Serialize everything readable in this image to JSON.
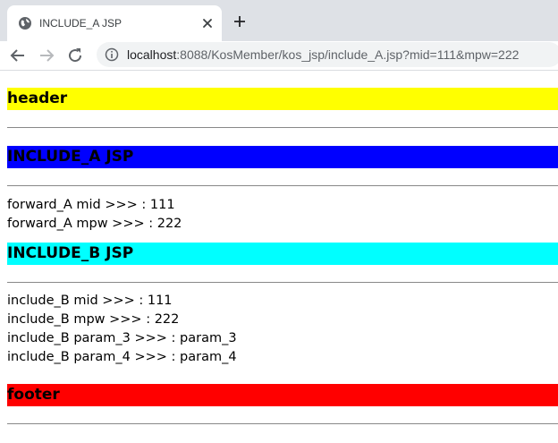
{
  "browser": {
    "tab_title": "INCLUDE_A JSP",
    "url_host": "localhost",
    "url_rest": ":8088/KosMember/kos_jsp/include_A.jsp?mid=111&mpw=222"
  },
  "header": {
    "text": "header",
    "color": "#ffff00"
  },
  "include_a": {
    "title": "INCLUDE_A JSP",
    "color": "#0000ff",
    "lines": [
      "forward_A mid >>> : 111",
      "forward_A mpw >>> : 222"
    ]
  },
  "include_b": {
    "title": "INCLUDE_B JSP",
    "color": "#00ffff",
    "lines": [
      "include_B mid >>> : 111",
      "include_B mpw >>> : 222",
      "include_B param_3 >>> : param_3",
      "include_B param_4 >>> : param_4"
    ]
  },
  "footer": {
    "text": "footer",
    "color": "#ff0000"
  },
  "icons": {
    "favicon": "globe-icon",
    "tab_close": "close-icon",
    "new_tab": "plus-icon",
    "back": "arrow-left-icon",
    "forward": "arrow-right-icon",
    "reload": "reload-icon",
    "site_info": "info-icon"
  }
}
